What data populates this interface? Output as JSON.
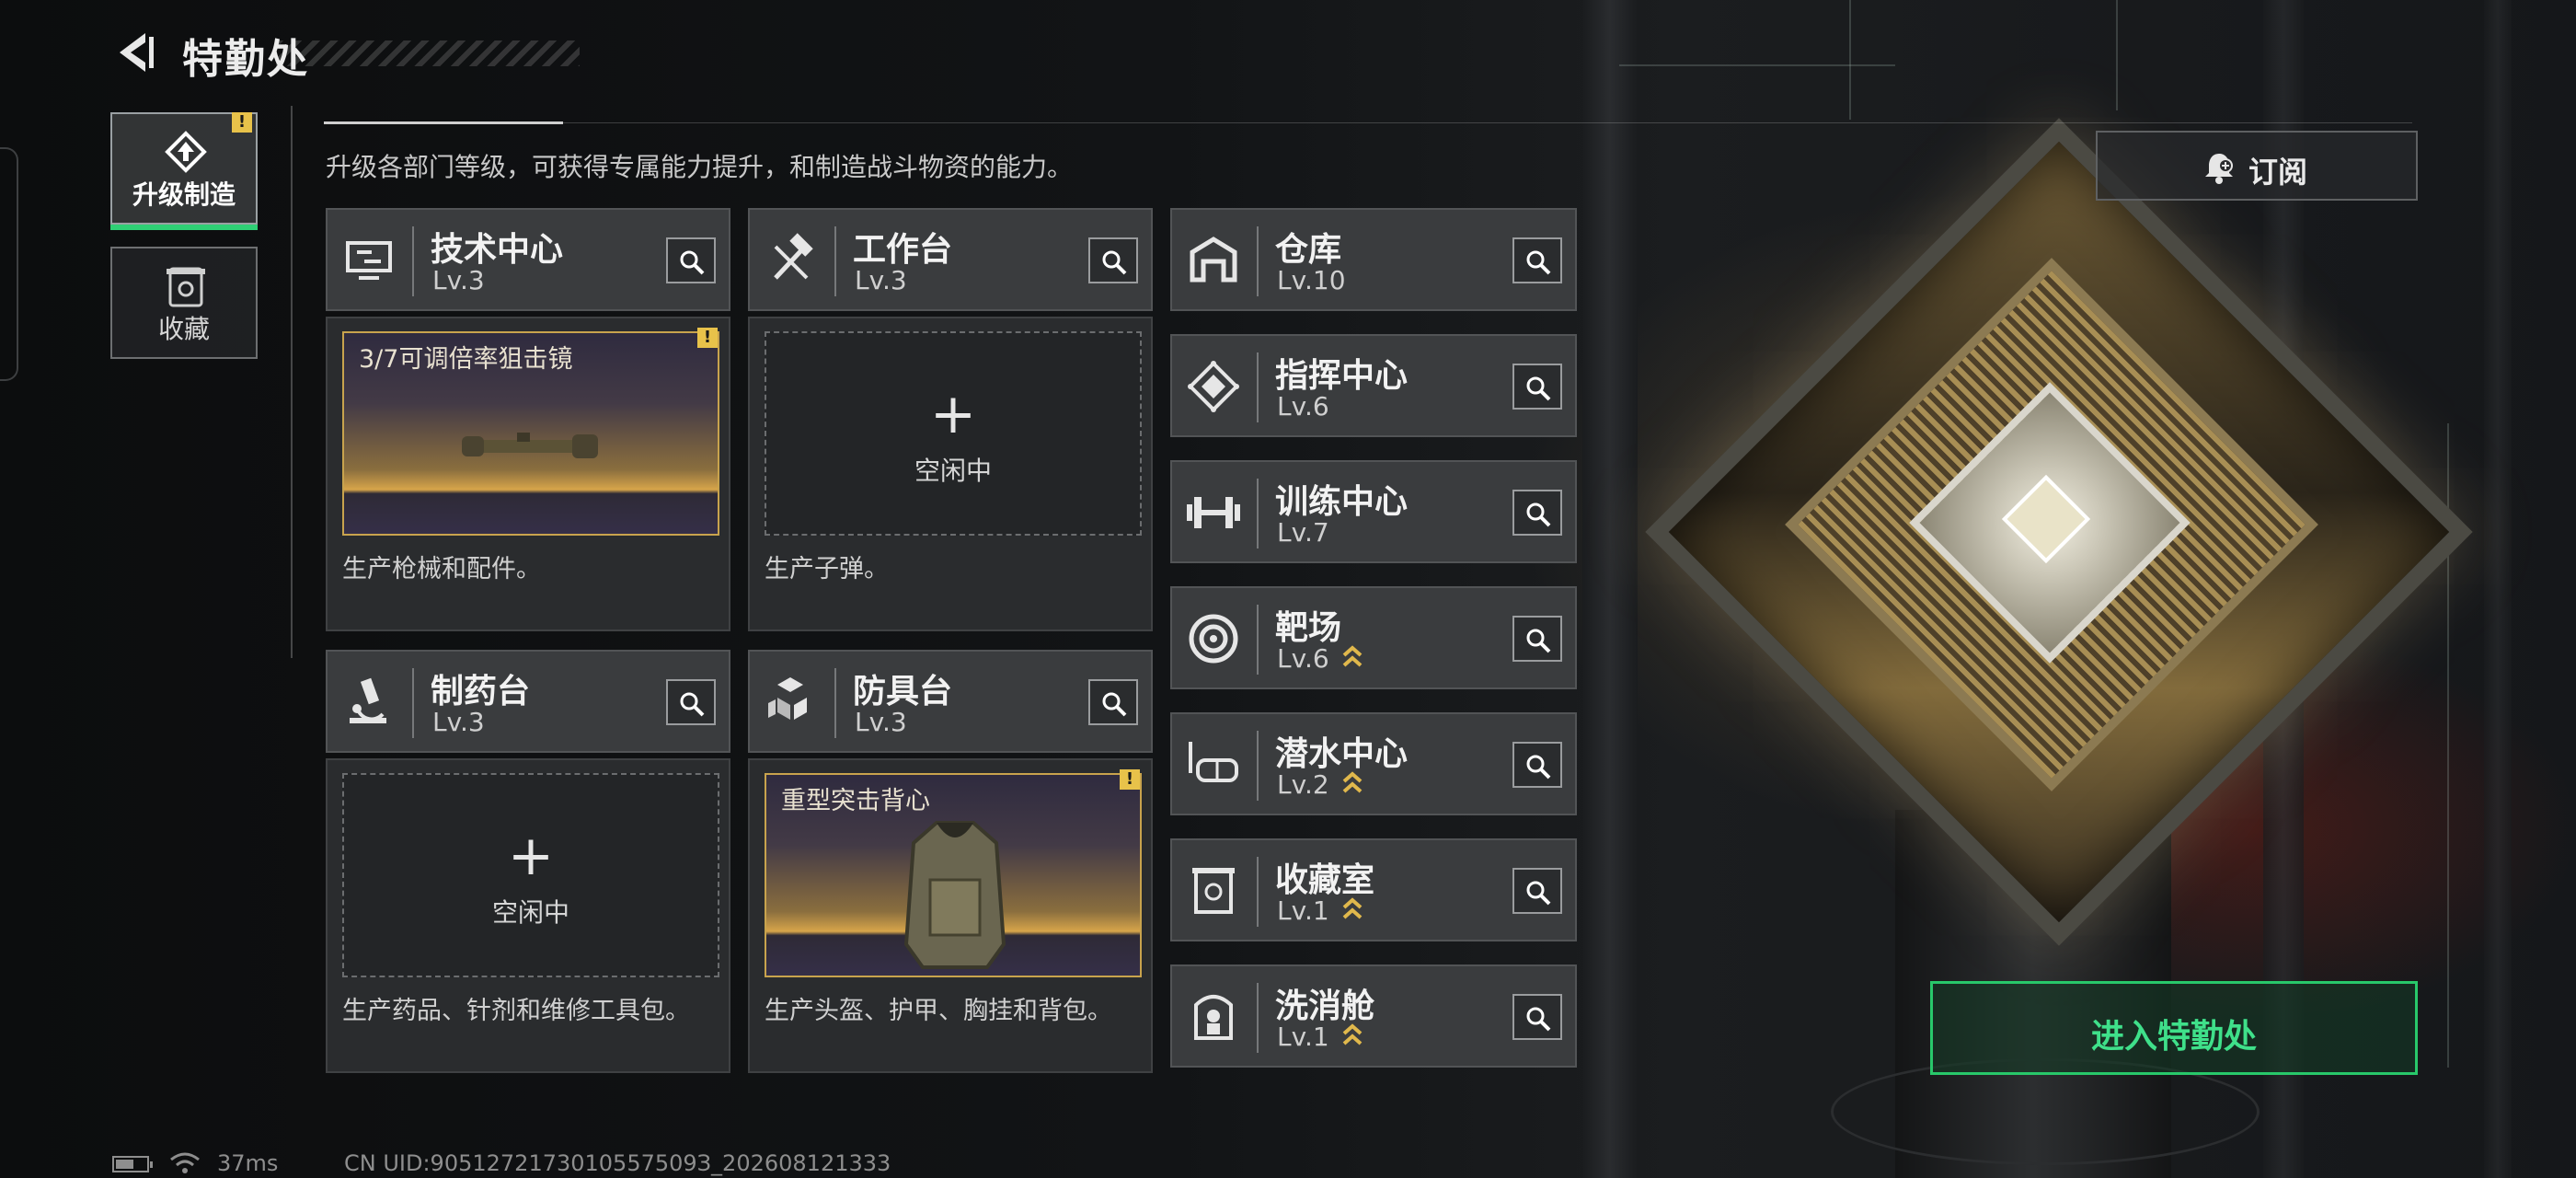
{
  "header": {
    "title": "特勤处",
    "description": "升级各部门等级，可获得专属能力提升，和制造战斗物资的能力。"
  },
  "sidebar": {
    "items": [
      {
        "label": "升级制造",
        "active": true,
        "alert": "!"
      },
      {
        "label": "收藏",
        "active": false
      }
    ]
  },
  "production": [
    {
      "name": "技术中心",
      "level": "Lv.3",
      "status": "3/7可调倍率狙击镜",
      "alert": "!",
      "description": "生产枪械和配件。",
      "icon": "monitor-icon"
    },
    {
      "name": "工作台",
      "level": "Lv.3",
      "status_plus": "+",
      "status": "空闲中",
      "description": "生产子弹。",
      "icon": "hammer-icon"
    },
    {
      "name": "制药台",
      "level": "Lv.3",
      "status_plus": "+",
      "status": "空闲中",
      "description": "生产药品、针剂和维修工具包。",
      "icon": "microscope-icon"
    },
    {
      "name": "防具台",
      "level": "Lv.3",
      "status": "重型突击背心",
      "alert": "!",
      "description": "生产头盔、护甲、胸挂和背包。",
      "icon": "cubes-icon"
    }
  ],
  "departments": [
    {
      "name": "仓库",
      "level": "Lv.10",
      "upgradable": false,
      "icon": "warehouse-icon"
    },
    {
      "name": "指挥中心",
      "level": "Lv.6",
      "upgradable": false,
      "icon": "chip-icon"
    },
    {
      "name": "训练中心",
      "level": "Lv.7",
      "upgradable": false,
      "icon": "dumbbell-icon"
    },
    {
      "name": "靶场",
      "level": "Lv.6",
      "upgradable": true,
      "icon": "target-icon"
    },
    {
      "name": "潜水中心",
      "level": "Lv.2",
      "upgradable": true,
      "icon": "dive-mask-icon"
    },
    {
      "name": "收藏室",
      "level": "Lv.1",
      "upgradable": true,
      "icon": "display-case-icon"
    },
    {
      "name": "洗消舱",
      "level": "Lv.1",
      "upgradable": true,
      "icon": "decon-chamber-icon"
    }
  ],
  "actions": {
    "subscribe": "订阅",
    "enter": "进入特勤处"
  },
  "status_bar": {
    "ping": "37ms",
    "uid": "CN UID:9051272173010557509З_202608121333",
    "battery_level": 0.6
  },
  "colors": {
    "accent_green": "#2fd075",
    "alert_yellow": "#e8c24a",
    "upgrade_gold": "#e0b84c"
  }
}
